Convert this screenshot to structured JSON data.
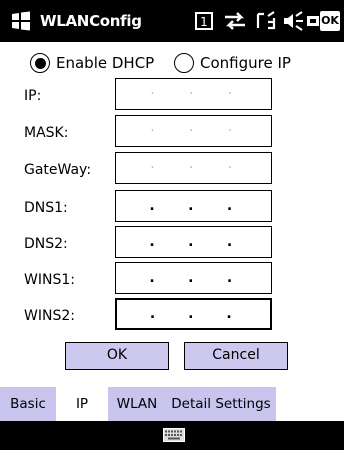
{
  "titlebar": {
    "app_title": "WLANConfig",
    "ok_label": "OK",
    "icons": [
      "start-icon",
      "sim-icon",
      "connectivity-icon",
      "signal-icon",
      "volume-icon",
      "battery-icon"
    ]
  },
  "dhcp": {
    "enable_label": "Enable DHCP",
    "configure_label": "Configure IP",
    "selected": "enable"
  },
  "fields": [
    {
      "label": "IP:",
      "value": ". . .",
      "enabled": false
    },
    {
      "label": "MASK:",
      "value": ". . .",
      "enabled": false
    },
    {
      "label": "GateWay:",
      "value": ". . .",
      "enabled": false
    },
    {
      "label": "DNS1:",
      "value": ". . .",
      "enabled": true
    },
    {
      "label": "DNS2:",
      "value": ". . .",
      "enabled": true
    },
    {
      "label": "WINS1:",
      "value": ". . .",
      "enabled": true
    },
    {
      "label": "WINS2:",
      "value": ". . .",
      "enabled": true
    }
  ],
  "buttons": {
    "ok": "OK",
    "cancel": "Cancel"
  },
  "tabs": {
    "items": [
      "Basic",
      "IP",
      "WLAN",
      "Detail Settings"
    ],
    "active": "IP"
  },
  "menubar": {
    "icon": "keyboard-icon"
  },
  "colors": {
    "titlebar": "#000000",
    "button_fill": "#ccc8ee",
    "tab_fill": "#c8c4ee"
  }
}
